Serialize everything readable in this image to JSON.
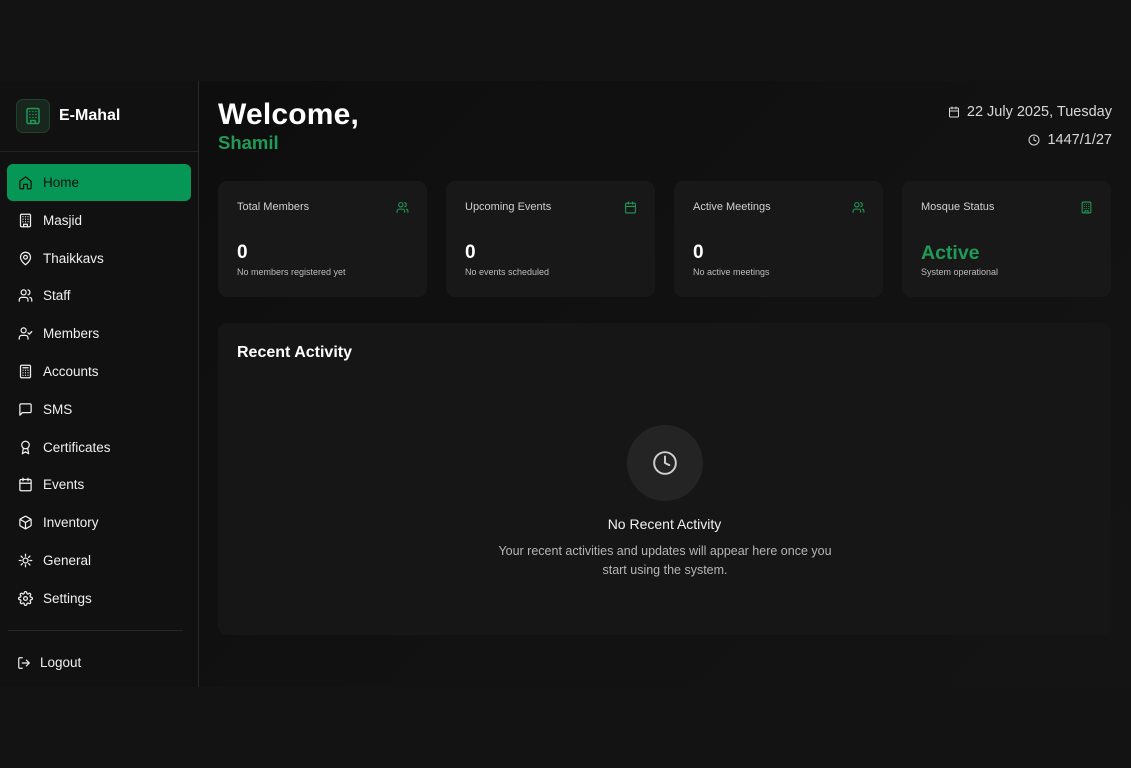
{
  "brand": {
    "name": "E-Mahal",
    "logo_icon": "building-icon"
  },
  "colors": {
    "accent": "#069655",
    "accent_text": "#1f9a57",
    "background": "#101010",
    "card": "#181818"
  },
  "sidebar": {
    "items": [
      {
        "label": "Home",
        "icon": "home-icon",
        "active": true
      },
      {
        "label": "Masjid",
        "icon": "building-icon"
      },
      {
        "label": "Thaikkavs",
        "icon": "map-pin-icon"
      },
      {
        "label": "Staff",
        "icon": "users-icon"
      },
      {
        "label": "Members",
        "icon": "user-check-icon"
      },
      {
        "label": "Accounts",
        "icon": "calculator-icon"
      },
      {
        "label": "SMS",
        "icon": "message-icon"
      },
      {
        "label": "Certificates",
        "icon": "award-icon"
      },
      {
        "label": "Events",
        "icon": "calendar-icon"
      },
      {
        "label": "Inventory",
        "icon": "package-icon"
      },
      {
        "label": "General",
        "icon": "cog-icon"
      },
      {
        "label": "Settings",
        "icon": "settings-icon"
      }
    ],
    "logout": "Logout"
  },
  "header": {
    "welcome": "Welcome,",
    "username": "Shamil",
    "date": "22 July 2025, Tuesday",
    "hijri_date": "1447/1/27"
  },
  "stats": [
    {
      "title": "Total Members",
      "value": "0",
      "subtitle": "No members registered yet",
      "icon": "users-icon"
    },
    {
      "title": "Upcoming Events",
      "value": "0",
      "subtitle": "No events scheduled",
      "icon": "calendar-icon"
    },
    {
      "title": "Active Meetings",
      "value": "0",
      "subtitle": "No active meetings",
      "icon": "users-icon"
    },
    {
      "title": "Mosque Status",
      "value": "Active",
      "subtitle": "System operational",
      "icon": "building-icon"
    }
  ],
  "activity": {
    "title": "Recent Activity",
    "empty_title": "No Recent Activity",
    "empty_desc": "Your recent activities and updates will appear here once you start using the system."
  }
}
